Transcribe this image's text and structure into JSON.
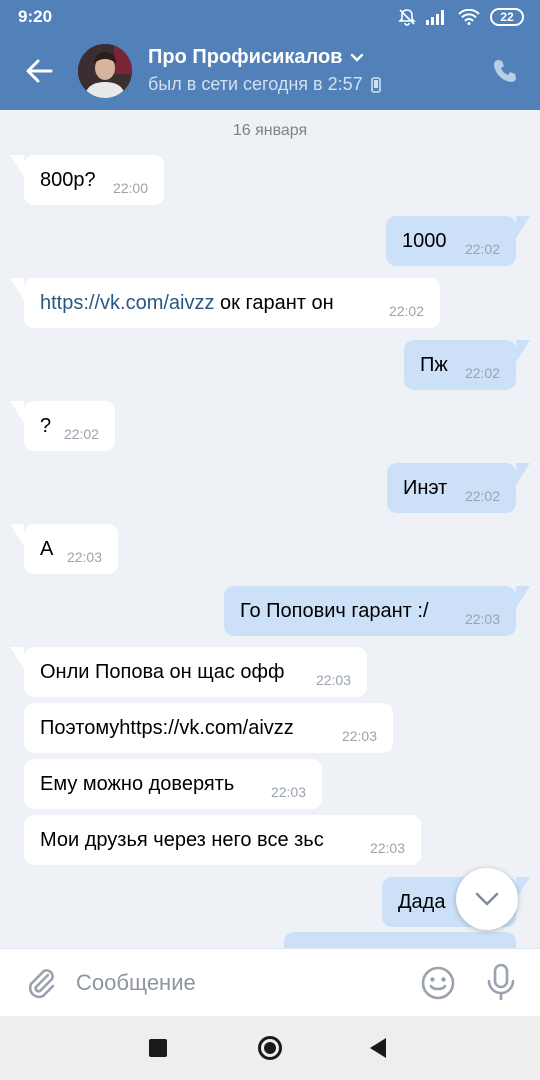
{
  "status_bar": {
    "time": "9:20",
    "battery": "22"
  },
  "header": {
    "name": "Про Профисикалов",
    "last_seen": "был в сети сегодня в 2:57"
  },
  "chat": {
    "date_separator": "16 января",
    "messages": [
      {
        "direction": "in",
        "text": "800р?",
        "time": "22:00"
      },
      {
        "direction": "out",
        "text": "1000",
        "time": "22:02"
      },
      {
        "direction": "in",
        "link": "https://vk.com/aivzz",
        "text": " ок гарант он",
        "time": "22:02"
      },
      {
        "direction": "out",
        "text": "Пж",
        "time": "22:02"
      },
      {
        "direction": "in",
        "text": "?",
        "time": "22:02"
      },
      {
        "direction": "out",
        "text": "Инэт",
        "time": "22:02"
      },
      {
        "direction": "in",
        "text": "А",
        "time": "22:03"
      },
      {
        "direction": "out",
        "text": "Го Попович гарант :/",
        "time": "22:03"
      },
      {
        "direction": "in",
        "text": "Онли Попова он щас офф",
        "time": "22:03"
      },
      {
        "direction": "in",
        "text": "Поэтомуhttps://vk.com/aivzz",
        "time": "22:03"
      },
      {
        "direction": "in",
        "text": "Ему можно доверять",
        "time": "22:03"
      },
      {
        "direction": "in",
        "text": "Мои друзья через него все зьс",
        "time": "22:03"
      },
      {
        "direction": "out",
        "text": "Дада",
        "time": ""
      }
    ]
  },
  "composer": {
    "placeholder": "Сообщение"
  },
  "colors": {
    "header": "#5181b8",
    "outgoing_bubble": "#cce0f8",
    "incoming_bubble": "#ffffff",
    "link": "#2a5885",
    "background": "#eef1f5"
  }
}
